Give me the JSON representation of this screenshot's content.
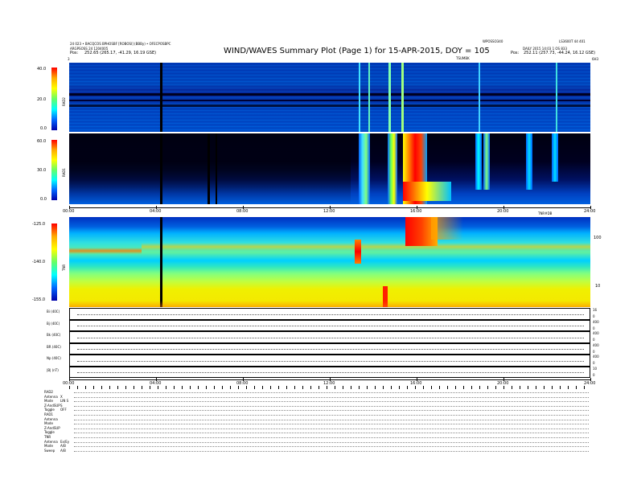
{
  "header": {
    "left_line1": "24 023 • BACQCOS BPHOSBF [ROBOSI] (BBBy) • OFECPOSBPC",
    "left_line2": "ARGPSOSS 24 1204005",
    "left_pos": "Pos:",
    "left_pos_value": "252.65 (265.17, -41.29, 16.19 GSE)",
    "title": "WIND/WAVES Summary Plot (Page 1) for 15-APR-2015, DOY = 105",
    "right_line1": "WPOSSO340",
    "right_line1b": "LS3600T 44 401",
    "right_line2": "DAILY  2015 14:03 1 OS 833",
    "right_pos": "Pos:",
    "right_pos_value": "252.11 (257.73, -44.24, 16.12 GSE)",
    "tsum": "TSUMBK"
  },
  "colorbar_labels": {
    "rad2": [
      "40.0",
      "20.0",
      "0.0"
    ],
    "rad1": [
      "60.0",
      "30.0",
      "0.0"
    ],
    "tnr": [
      "-125.0",
      "-140.0",
      "-155.0"
    ]
  },
  "axis_labels": {
    "rad2": "RAD2",
    "rad1": "RAD1",
    "tnr": "TNR",
    "right_tnr_ticks": [
      "100",
      "10"
    ],
    "right_ticks_top": [
      "3",
      "6H3"
    ],
    "seg_label": "TNR#DB"
  },
  "time_ticks": [
    "00:00",
    "04:00",
    "08:00",
    "12:00",
    "16:00",
    "20:00",
    "24:00"
  ],
  "line_panels": [
    {
      "label": "Bi (40C)",
      "r1": "16",
      "r2": "0"
    },
    {
      "label": "Bj (40C)",
      "r1": "400",
      "r2": "0"
    },
    {
      "label": "Bk (40C)",
      "r1": "400",
      "r2": "0"
    },
    {
      "label": "BR (40C)",
      "r1": "400",
      "r2": "0"
    },
    {
      "label": "Np (40C)",
      "r1": "400",
      "r2": "0"
    },
    {
      "label": "|B| (nT)",
      "r1": "10",
      "r2": "0"
    }
  ],
  "status_rows": [
    {
      "label": "RAD2",
      "value": ""
    },
    {
      "label": "Antenna",
      "value": "X"
    },
    {
      "label": "Mode",
      "value": "LIN S"
    },
    {
      "label": "Z-AndSUP",
      "value": "S"
    },
    {
      "label": "Toggle",
      "value": "OFF"
    },
    {
      "label": "RAD1",
      "value": ""
    },
    {
      "label": "Antenna",
      "value": ""
    },
    {
      "label": "Mode",
      "value": ""
    },
    {
      "label": "Z-AndSUP",
      "value": ""
    },
    {
      "label": "Toggle",
      "value": ""
    },
    {
      "label": "TNR",
      "value": ""
    },
    {
      "label": "Antenna",
      "value": "Ex/Ey"
    },
    {
      "label": "Mode",
      "value": "A/B"
    },
    {
      "label": "Sweep",
      "value": "A/B"
    }
  ],
  "colors": {
    "background": "#ffffff",
    "spectrogram_low": "#00008f",
    "spectrogram_high": "#ff0000",
    "tnr_band": "#f5e600"
  }
}
